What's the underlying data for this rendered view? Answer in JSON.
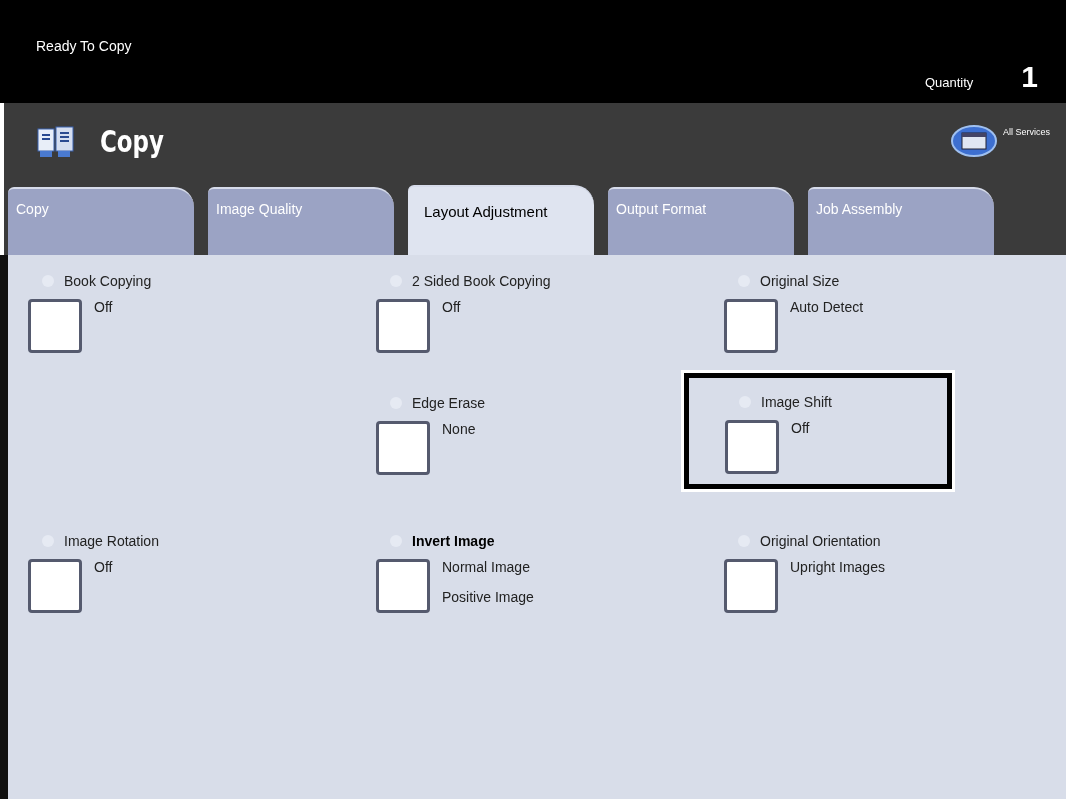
{
  "status": {
    "message": "Ready To Copy",
    "quantity_label": "Quantity",
    "quantity": "1"
  },
  "service": {
    "title": "Copy",
    "all_services": "All Services"
  },
  "tabs": [
    {
      "label": "Copy",
      "selected": false
    },
    {
      "label": "Image Quality",
      "selected": false
    },
    {
      "label": "Layout Adjustment",
      "selected": true
    },
    {
      "label": "Output Format",
      "selected": false
    },
    {
      "label": "Job Assembly",
      "selected": false
    }
  ],
  "rows": [
    [
      {
        "title": "Book Copying",
        "bold": false,
        "highlighted": false,
        "values": [
          "Off"
        ]
      },
      {
        "title": "2 Sided Book Copying",
        "bold": false,
        "highlighted": false,
        "values": [
          "Off"
        ]
      },
      {
        "title": "Original Size",
        "bold": false,
        "highlighted": false,
        "values": [
          "Auto Detect"
        ]
      }
    ],
    [
      {
        "title": "Edge Erase",
        "bold": false,
        "highlighted": false,
        "values": [
          "None"
        ]
      },
      {
        "title": "Image Shift",
        "bold": false,
        "highlighted": true,
        "values": [
          "Off"
        ]
      }
    ],
    [
      {
        "title": "Image Rotation",
        "bold": false,
        "highlighted": false,
        "values": [
          "Off"
        ]
      },
      {
        "title": "Invert Image",
        "bold": true,
        "highlighted": false,
        "values": [
          "Normal Image",
          "Positive Image"
        ]
      },
      {
        "title": "Original Orientation",
        "bold": false,
        "highlighted": false,
        "values": [
          "Upright Images"
        ]
      }
    ]
  ]
}
